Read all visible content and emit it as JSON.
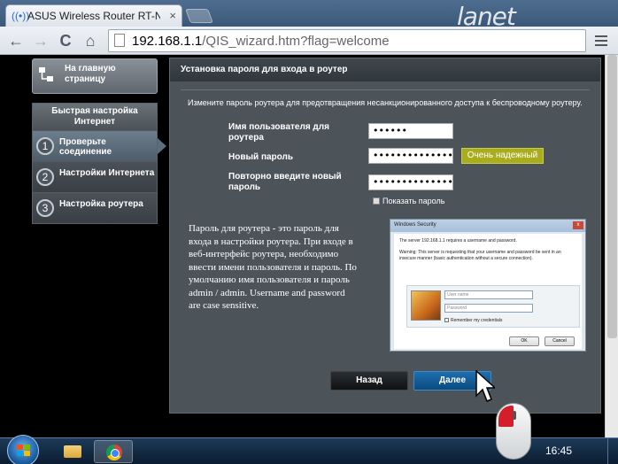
{
  "browser": {
    "tab_title": "ASUS Wireless Router RT-N",
    "tab_close": "×",
    "brand": "lanet",
    "back": "←",
    "forward": "→",
    "reload": "C",
    "home": "⌂",
    "url_host": "192.168.1.1",
    "url_path": "/QIS_wizard.htm?flag=welcome"
  },
  "sidebar": {
    "home_label": "На главную страницу",
    "wizard_title": "Быстрая настройка Интернет",
    "steps": [
      {
        "num": "1",
        "label": "Проверьте соединение"
      },
      {
        "num": "2",
        "label": "Настройки Интернета"
      },
      {
        "num": "3",
        "label": "Настройка роутера"
      }
    ]
  },
  "main": {
    "title": "Установка пароля для входа в роутер",
    "description": "Измените пароль роутера для предотвращения несанкционированного доступа к беспроводному роутеру.",
    "username_label": "Имя пользователя для роутера",
    "username_value": "••••••",
    "password_label": "Новый пароль",
    "password_value": "••••••••••••••••••••",
    "strength": "Очень надежный",
    "confirm_label": "Повторно введите новый пароль",
    "confirm_value": "••••••••••••••••••••",
    "show_password": "Показать пароль",
    "info_text": "Пароль для роутера - это пароль для входа в настройки роутера. При входе в веб-интерфейс роутера, необходимо ввести имени пользователя и пароль. По умолчанию имя пользователя и пароль admin / admin. Username and password are case sensitive.",
    "back_button": "Назад",
    "next_button": "Далее"
  },
  "windows_security": {
    "title": "Windows Security",
    "close": "x",
    "line1": "The server 192.168.1.1 requires a username and password.",
    "line2": "Warning: This server is requesting that your username and password be sent in an insecure manner (basic authentication without a secure connection).",
    "username_placeholder": "User name",
    "password_placeholder": "Password",
    "remember": "Remember my credentials",
    "ok": "OK",
    "cancel": "Cancel"
  },
  "taskbar": {
    "clock": "16:45"
  }
}
